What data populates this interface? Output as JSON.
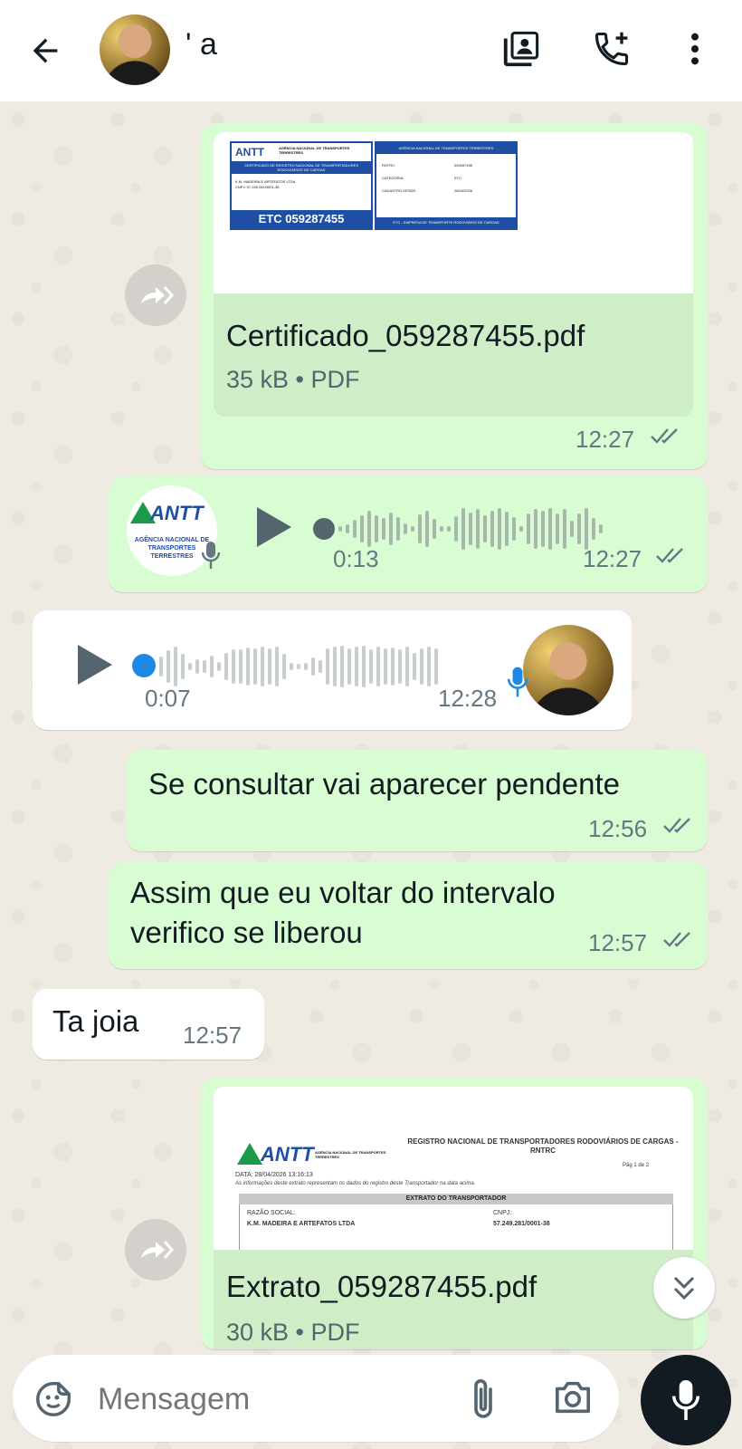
{
  "header": {
    "contact_name": "'  a",
    "icons": [
      "back-arrow-icon",
      "contact-card-icon",
      "add-call-icon",
      "more-vert-icon"
    ]
  },
  "messages": {
    "doc1": {
      "file_name": "Certificado_059287455.pdf",
      "meta": "35 kB • PDF",
      "time": "12:27",
      "preview": {
        "logo": "ANTT",
        "agency": "AGÊNCIA NACIONAL DE TRANSPORTES TERRESTRES",
        "title": "CERTIFICADO DE REGISTRO NACIONAL DE TRANSPORTADORES RODOVIÁRIOS DE CARGAS",
        "company": "K.M. MADEIRA E ARTEFATOS LTDA",
        "cnpj": "CNPJ: 57.249.281/0001-38",
        "etc": "ETC 059287455",
        "right_header": "AGÊNCIA NACIONAL DE TRANSPORTES TERRESTRES",
        "rntrc_label": "RNTRC:",
        "rntrc_value": "059287455",
        "cat_label": "CATEGORIA:",
        "cat_value": "ETC",
        "date_label": "CADASTRO DESDE:",
        "date_value": "28/04/2026",
        "footer": "ETC - EMPRESA DE TRANSPORTE RODOVIÁRIO DE CARGAS"
      }
    },
    "audio1": {
      "duration": "0:13",
      "time": "12:27",
      "avatar_logo": "ANTT",
      "avatar_text": "AGÊNCIA NACIONAL DE TRANSPORTES TERRESTRES"
    },
    "audio2": {
      "duration": "0:07",
      "time": "12:28"
    },
    "text1": {
      "text": "Se consultar vai aparecer pendente",
      "time": "12:56"
    },
    "text2": {
      "line1": "Assim que eu voltar do intervalo",
      "line2": "verifico se liberou",
      "time": "12:57"
    },
    "text3": {
      "text": "Ta joia",
      "time": "12:57"
    },
    "doc2": {
      "file_name": "Extrato_059287455.pdf",
      "meta": "30 kB • PDF",
      "preview": {
        "logo": "ANTT",
        "agency": "AGÊNCIA NACIONAL DE TRANSPORTES TERRESTRES",
        "title": "REGISTRO NACIONAL DE TRANSPORTADORES RODOVIÁRIOS DE CARGAS - RNTRC",
        "page": "Pág 1 de 2",
        "data": "DATA: 28/04/2026 13:16:13",
        "info": "As informações deste extrato representam os dados do registro deste Transportador na data acima.",
        "section": "EXTRATO DO TRANSPORTADOR",
        "razao_label": "RAZÃO SOCIAL:",
        "razao_value": "K.M. MADEIRA E ARTEFATOS LTDA",
        "cnpj_label": "CNPJ:",
        "cnpj_value": "57.249.281/0001-38"
      }
    }
  },
  "input": {
    "placeholder": "Mensagem"
  },
  "colors": {
    "outgoing": "#d9fdd3",
    "incoming": "#ffffff",
    "wallpaper": "#efeae2",
    "unread_dot": "#1e88e5"
  }
}
